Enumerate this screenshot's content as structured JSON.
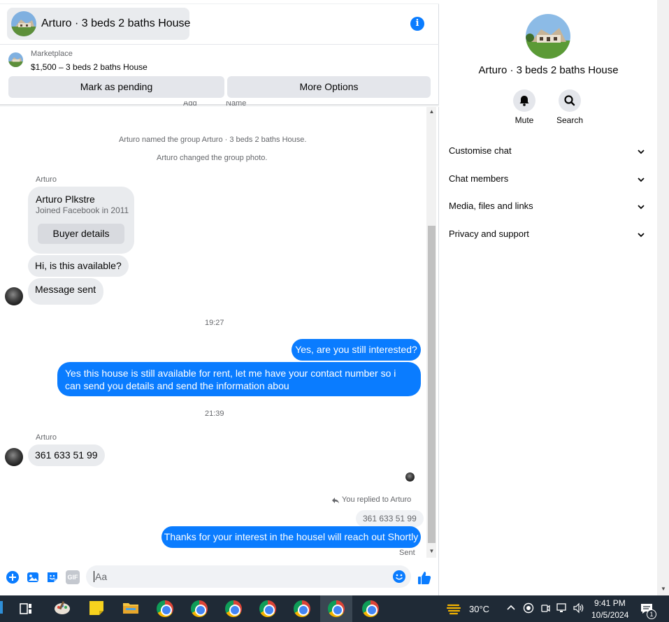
{
  "header": {
    "title": "Arturo · 3 beds 2 baths House",
    "marketplace_label": "Marketplace",
    "listing_line": "$1,500 – 3 beds 2 baths House",
    "mark_pending_label": "Mark as pending",
    "more_options_label": "More Options",
    "cut_text_left": "Add",
    "cut_text_right": "Name"
  },
  "messages": {
    "system_named": "Arturo named the group Arturo · 3 beds 2 baths House.",
    "system_photo": "Arturo changed the group photo.",
    "sender_1": "Arturo",
    "buyer_name": "Arturo Plkstre",
    "buyer_joined": "Joined Facebook in 2011",
    "buyer_details_label": "Buyer details",
    "incoming_1": "Hi, is this available?",
    "incoming_2": "Message sent",
    "time_1": "19:27",
    "outgoing_1": "Yes, are you still interested?",
    "outgoing_2": "Yes this house is still available for rent, let me have your contact number so i can send you details and send the information abou",
    "time_2": "21:39",
    "sender_2": "Arturo",
    "incoming_3": "361 633 51 99",
    "reply_note": "You replied to Arturo",
    "quoted": "361 633 51 99",
    "outgoing_3": "Thanks for your interest in the housel will reach out Shortly",
    "status": "Sent"
  },
  "composer": {
    "placeholder": "Aa",
    "gif_label": "GIF"
  },
  "info": {
    "title": "Arturo · 3 beds 2 baths House",
    "mute_label": "Mute",
    "search_label": "Search",
    "sections": [
      "Customise chat",
      "Chat members",
      "Media, files and links",
      "Privacy and support"
    ]
  },
  "taskbar": {
    "weather": "30°C",
    "time": "9:41 PM",
    "date": "10/5/2024",
    "notification_count": "1"
  },
  "colors": {
    "accent": "#0a7cff",
    "bubble_gray": "#e9ebee",
    "taskbar": "#1f2a36"
  },
  "icons": [
    "info-icon",
    "bell-icon",
    "search-icon",
    "chevron-down-icon",
    "plus-icon",
    "photo-icon",
    "sticker-icon",
    "gif-icon",
    "emoji-icon",
    "like-icon",
    "reply-icon"
  ]
}
